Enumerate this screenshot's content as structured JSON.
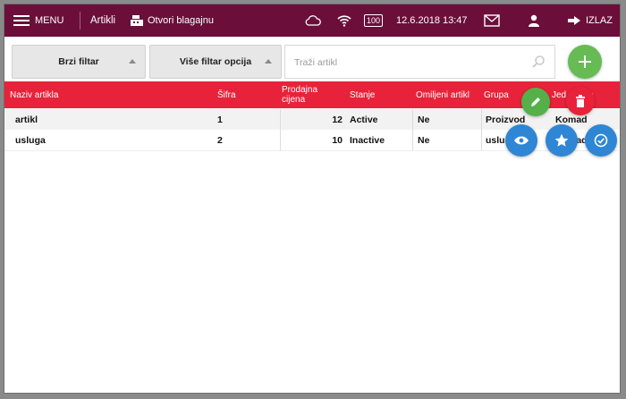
{
  "topbar": {
    "menu_label": "MENU",
    "section_title": "Artikli",
    "register_label": "Otvori blagajnu",
    "battery": "100",
    "datetime": "12.6.2018 13:47",
    "exit_label": "IZLAZ"
  },
  "filters": {
    "quick_filter": "Brzi filtar",
    "more_filters": "Više filtar opcija",
    "search_placeholder": "Traži artikl"
  },
  "table": {
    "headers": [
      "Naziv artikla",
      "Šifra",
      "Prodajna cijena",
      "Stanje",
      "Omiljeni artikl",
      "Grupa",
      "Jed. mjere"
    ],
    "rows": [
      {
        "name": "artikl",
        "code": "1",
        "price": "12",
        "status": "Active",
        "favorite": "Ne",
        "group": "Proizvod",
        "unit": "Komad"
      },
      {
        "name": "usluga",
        "code": "2",
        "price": "10",
        "status": "Inactive",
        "favorite": "Ne",
        "group": "usluga",
        "unit": "Komad"
      }
    ]
  },
  "colors": {
    "topbar": "#6b0f3a",
    "header": "#e8223a",
    "add": "#66bb55",
    "action_blue": "#2e86d4"
  },
  "icons": {
    "menu": "hamburger-icon",
    "register": "cash-register-icon",
    "cloud": "cloud-icon",
    "wifi": "wifi-icon",
    "mail": "mail-icon",
    "user": "user-icon",
    "exit": "arrow-right-icon",
    "search": "search-icon"
  }
}
